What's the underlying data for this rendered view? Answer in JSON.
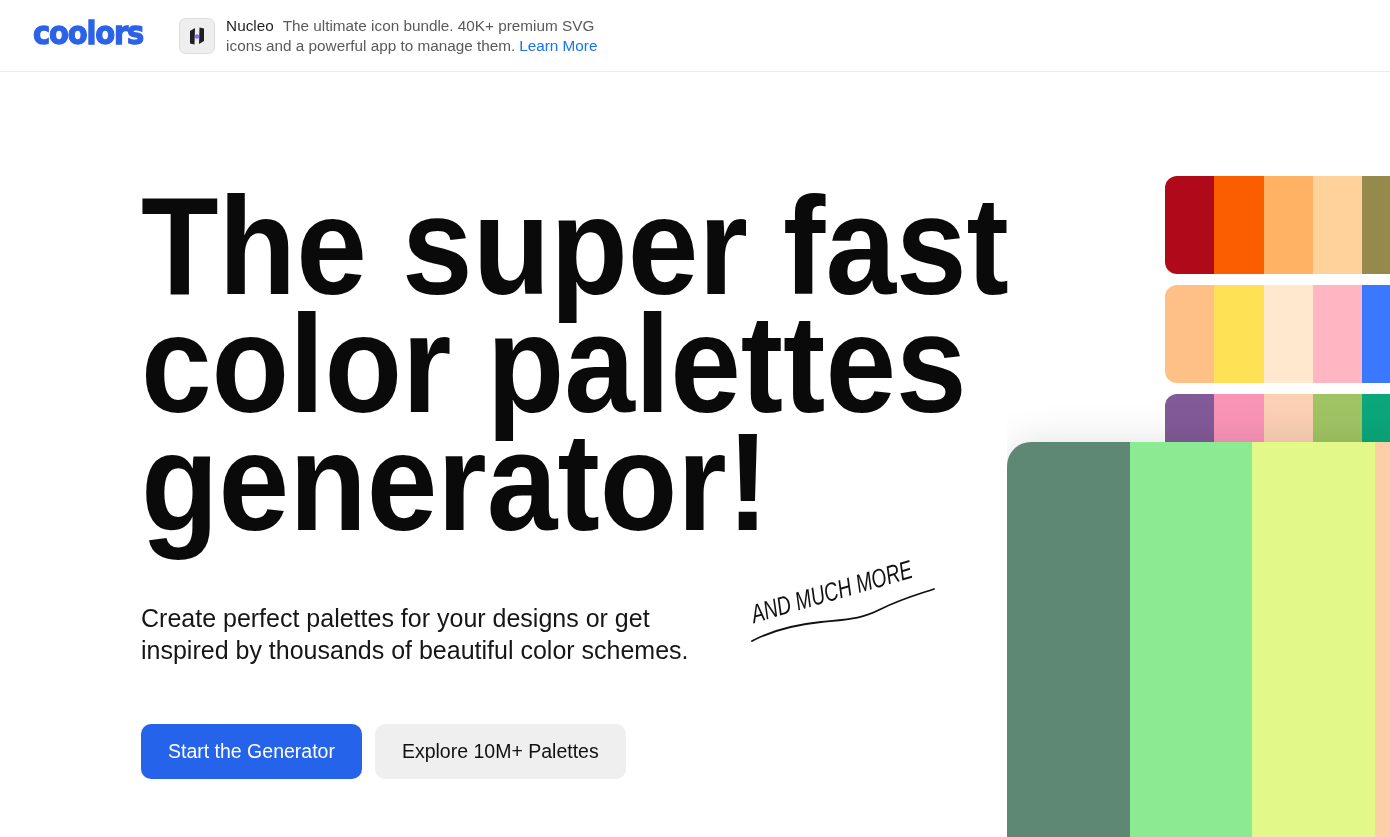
{
  "header": {
    "logo": "coolors",
    "ad": {
      "brand": "Nucleo",
      "text": "The ultimate icon bundle. 40K+ premium SVG icons and a powerful app to manage them.",
      "link": "Learn More"
    }
  },
  "hero": {
    "headline": "The super fast color palettes generator!",
    "note": "AND MUCH MORE",
    "subtitle": "Create perfect palettes for your designs or get inspired by thousands of beautiful color schemes.",
    "buttons": [
      {
        "label": "Start the Generator",
        "kind": "primary"
      },
      {
        "label": "Explore 10M+ Palettes",
        "kind": "secondary"
      }
    ]
  },
  "palettes": [
    {
      "kind": "small",
      "swatches": [
        {
          "color": "#b00a1a"
        },
        {
          "color": "#fa5e00"
        },
        {
          "color": "#ffb264"
        },
        {
          "color": "#ffd29c"
        },
        {
          "color": "#96894c"
        }
      ]
    },
    {
      "kind": "small",
      "swatches": [
        {
          "color": "#ffc088"
        },
        {
          "color": "#ffe156"
        },
        {
          "color": "#ffe8cd"
        },
        {
          "color": "#ffb6c2"
        },
        {
          "color": "#3a78ff"
        }
      ]
    },
    {
      "kind": "partial",
      "swatches": [
        {
          "color": "#825a98"
        },
        {
          "color": "#fa94b6"
        },
        {
          "color": "#fbd0b4"
        },
        {
          "color": "#a0c464"
        },
        {
          "color": "#0ba77a"
        }
      ]
    },
    {
      "kind": "large",
      "swatches": [
        {
          "color": "#5e8774"
        },
        {
          "color": "#8aeb92"
        },
        {
          "color": "#e2f98a"
        },
        {
          "color": "#fccfa8"
        }
      ]
    }
  ]
}
